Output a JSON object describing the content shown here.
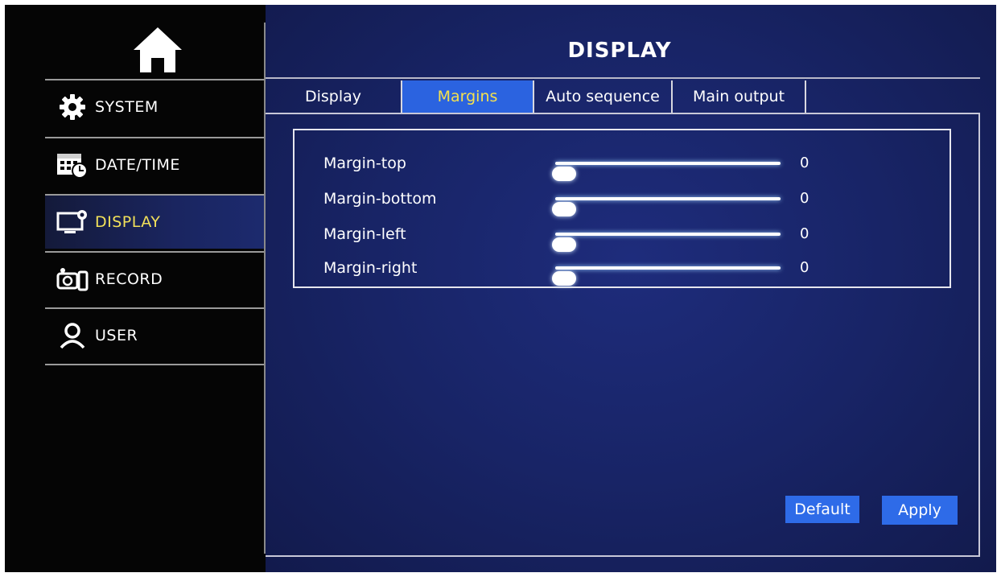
{
  "page_title": "DISPLAY",
  "sidebar": {
    "items": [
      {
        "label": "SYSTEM",
        "icon": "gear-icon"
      },
      {
        "label": "DATE/TIME",
        "icon": "calendar-clock-icon"
      },
      {
        "label": "DISPLAY",
        "icon": "monitor-settings-icon",
        "active": true
      },
      {
        "label": "RECORD",
        "icon": "camera-icon"
      },
      {
        "label": "USER",
        "icon": "user-icon"
      }
    ]
  },
  "tabs": [
    {
      "label": "Display"
    },
    {
      "label": "Margins",
      "active": true
    },
    {
      "label": "Auto sequence"
    },
    {
      "label": "Main output"
    }
  ],
  "margins": [
    {
      "label": "Margin-top",
      "value": "0",
      "level": 0
    },
    {
      "label": "Margin-bottom",
      "value": "0",
      "level": 0
    },
    {
      "label": "Margin-left",
      "value": "0",
      "level": 0
    },
    {
      "label": "Margin-right",
      "value": "0",
      "level": 0
    }
  ],
  "buttons": {
    "default": "Default",
    "apply": "Apply"
  },
  "colors": {
    "accent": "#2b63e0",
    "active_text": "#f4e04e",
    "background": "#182466"
  }
}
